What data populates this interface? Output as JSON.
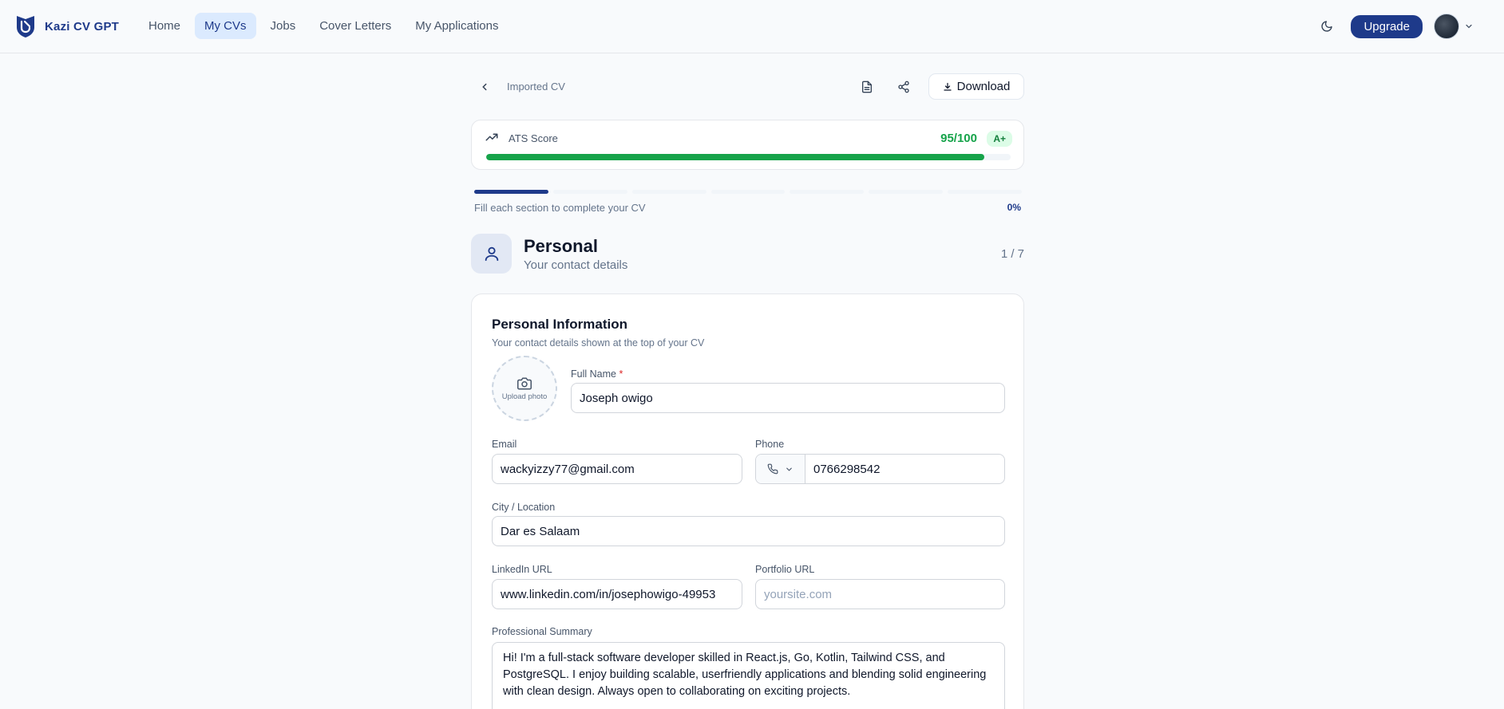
{
  "brand": {
    "name": "Kazi CV GPT"
  },
  "nav": {
    "items": [
      {
        "label": "Home",
        "active": false
      },
      {
        "label": "My CVs",
        "active": true
      },
      {
        "label": "Jobs",
        "active": false
      },
      {
        "label": "Cover Letters",
        "active": false
      },
      {
        "label": "My Applications",
        "active": false
      }
    ]
  },
  "topbar": {
    "upgrade_label": "Upgrade"
  },
  "editor": {
    "cv_title": "Imported CV",
    "download_label": "Download"
  },
  "ats": {
    "label": "ATS Score",
    "score_text": "95/100",
    "score_value": 95,
    "score_max": 100,
    "grade": "A+",
    "accent_color": "#16a34a"
  },
  "progress": {
    "hint": "Fill each section to complete your CV",
    "percent_text": "0%",
    "total_steps": 7,
    "current_step": 1
  },
  "section": {
    "title": "Personal",
    "subtitle": "Your contact details",
    "step_text": "1 / 7"
  },
  "form": {
    "title": "Personal Information",
    "subtitle": "Your contact details shown at the top of your CV",
    "photo_label": "Upload photo",
    "full_name": {
      "label": "Full Name",
      "required_mark": "*",
      "value": "Joseph owigo"
    },
    "email": {
      "label": "Email",
      "value": "wackyizzy77@gmail.com"
    },
    "phone": {
      "label": "Phone",
      "value": "0766298542"
    },
    "city": {
      "label": "City / Location",
      "value": "Dar es Salaam"
    },
    "linkedin": {
      "label": "LinkedIn URL",
      "value": "www.linkedin.com/in/josephowigo-49953"
    },
    "portfolio": {
      "label": "Portfolio URL",
      "value": "",
      "placeholder": "yoursite.com"
    },
    "summary": {
      "label": "Professional Summary",
      "value": "Hi! I'm a full-stack software developer skilled in React.js, Go, Kotlin, Tailwind CSS, and PostgreSQL. I enjoy building scalable, userfriendly applications and blending solid engineering with clean design. Always open to collaborating on exciting projects."
    }
  },
  "colors": {
    "brand": "#1e3a8a",
    "nav_active_bg": "#dbeafe",
    "success": "#16a34a"
  }
}
